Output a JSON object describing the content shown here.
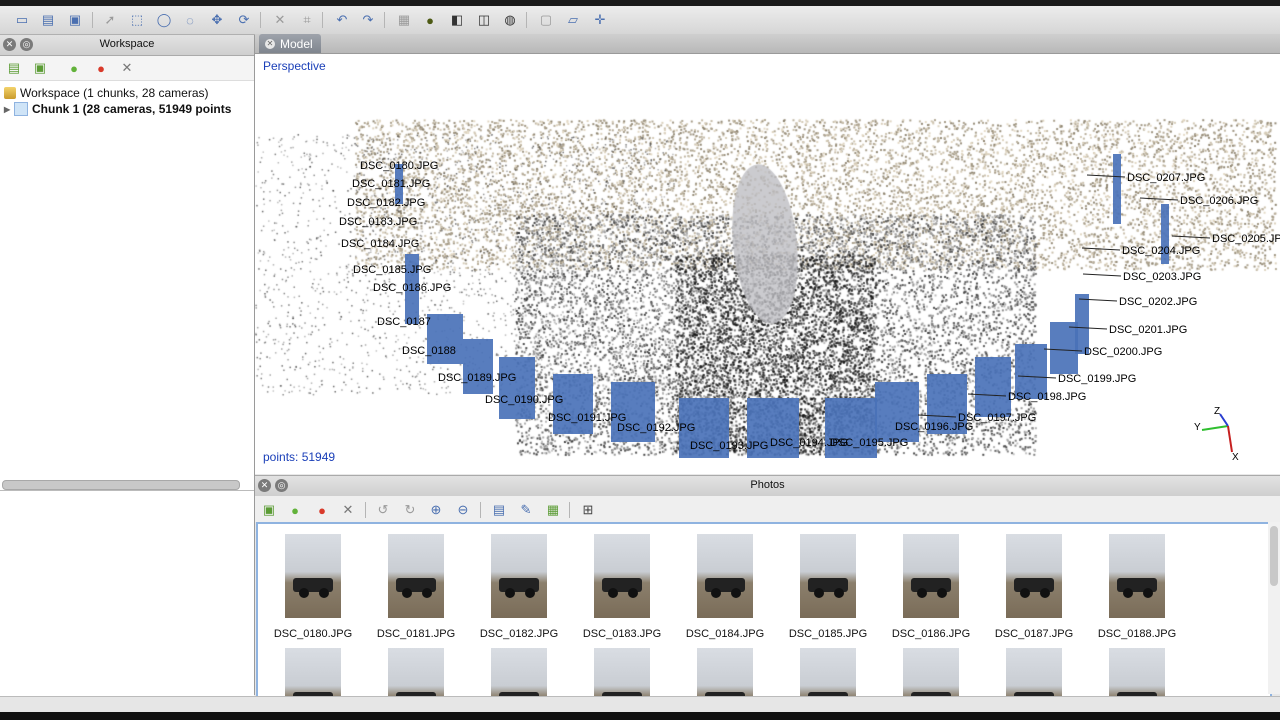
{
  "toolbar": {
    "icons": [
      "new-icon",
      "open-icon",
      "save-icon",
      "select-icon",
      "rect-select-icon",
      "circle-select-icon",
      "free-select-icon",
      "transform-icon",
      "align-icon",
      "delete-icon",
      "crop-icon",
      "undo-icon",
      "redo-icon",
      "grid-icon",
      "sphere-icon",
      "cube-icon",
      "cube-wire-icon",
      "ball-icon",
      "camera-icon",
      "plane-icon",
      "axes-icon"
    ]
  },
  "workspace": {
    "title": "Workspace",
    "tree": {
      "root": "Workspace (1 chunks, 28 cameras)",
      "chunk": "Chunk 1 (28 cameras, 51949 points"
    }
  },
  "model": {
    "tab_label": "Model",
    "view_mode": "Perspective",
    "points_label": "points: 51949",
    "axis_labels": {
      "x": "X",
      "y": "Y",
      "z": "Z"
    },
    "camera_labels_left": [
      "DSC_0180.JPG",
      "DSC_0181.JPG",
      "DSC_0182.JPG",
      "DSC_0183.JPG",
      "DSC_0184.JPG",
      "DSC_0185.JPG",
      "DSC_0186.JPG",
      "DSC_0187",
      "DSC_0188",
      "DSC_0189.JPG",
      "DSC_0190.JPG",
      "DSC_0191.JPG",
      "DSC_0192.JPG",
      "DSC_0193.JPG",
      "DSC_0194.JPG",
      "DSC_0195.JPG",
      "DSC_0196.JPG"
    ],
    "camera_labels_right": [
      "DSC_0207.JPG",
      "DSC_0206.JPG",
      "DSC_0205.JPG",
      "DSC_0204.JPG",
      "DSC_0203.JPG",
      "DSC_0202.JPG",
      "DSC_0201.JPG",
      "DSC_0200.JPG",
      "DSC_0199.JPG",
      "DSC_0198.JPG",
      "DSC_0197.JPG"
    ]
  },
  "photos": {
    "title": "Photos",
    "items": [
      "DSC_0180.JPG",
      "DSC_0181.JPG",
      "DSC_0182.JPG",
      "DSC_0183.JPG",
      "DSC_0184.JPG",
      "DSC_0185.JPG",
      "DSC_0186.JPG",
      "DSC_0187.JPG",
      "DSC_0188.JPG"
    ]
  },
  "colors": {
    "camera_plane": "#4a72b8",
    "accent": "#1a3fb8"
  }
}
